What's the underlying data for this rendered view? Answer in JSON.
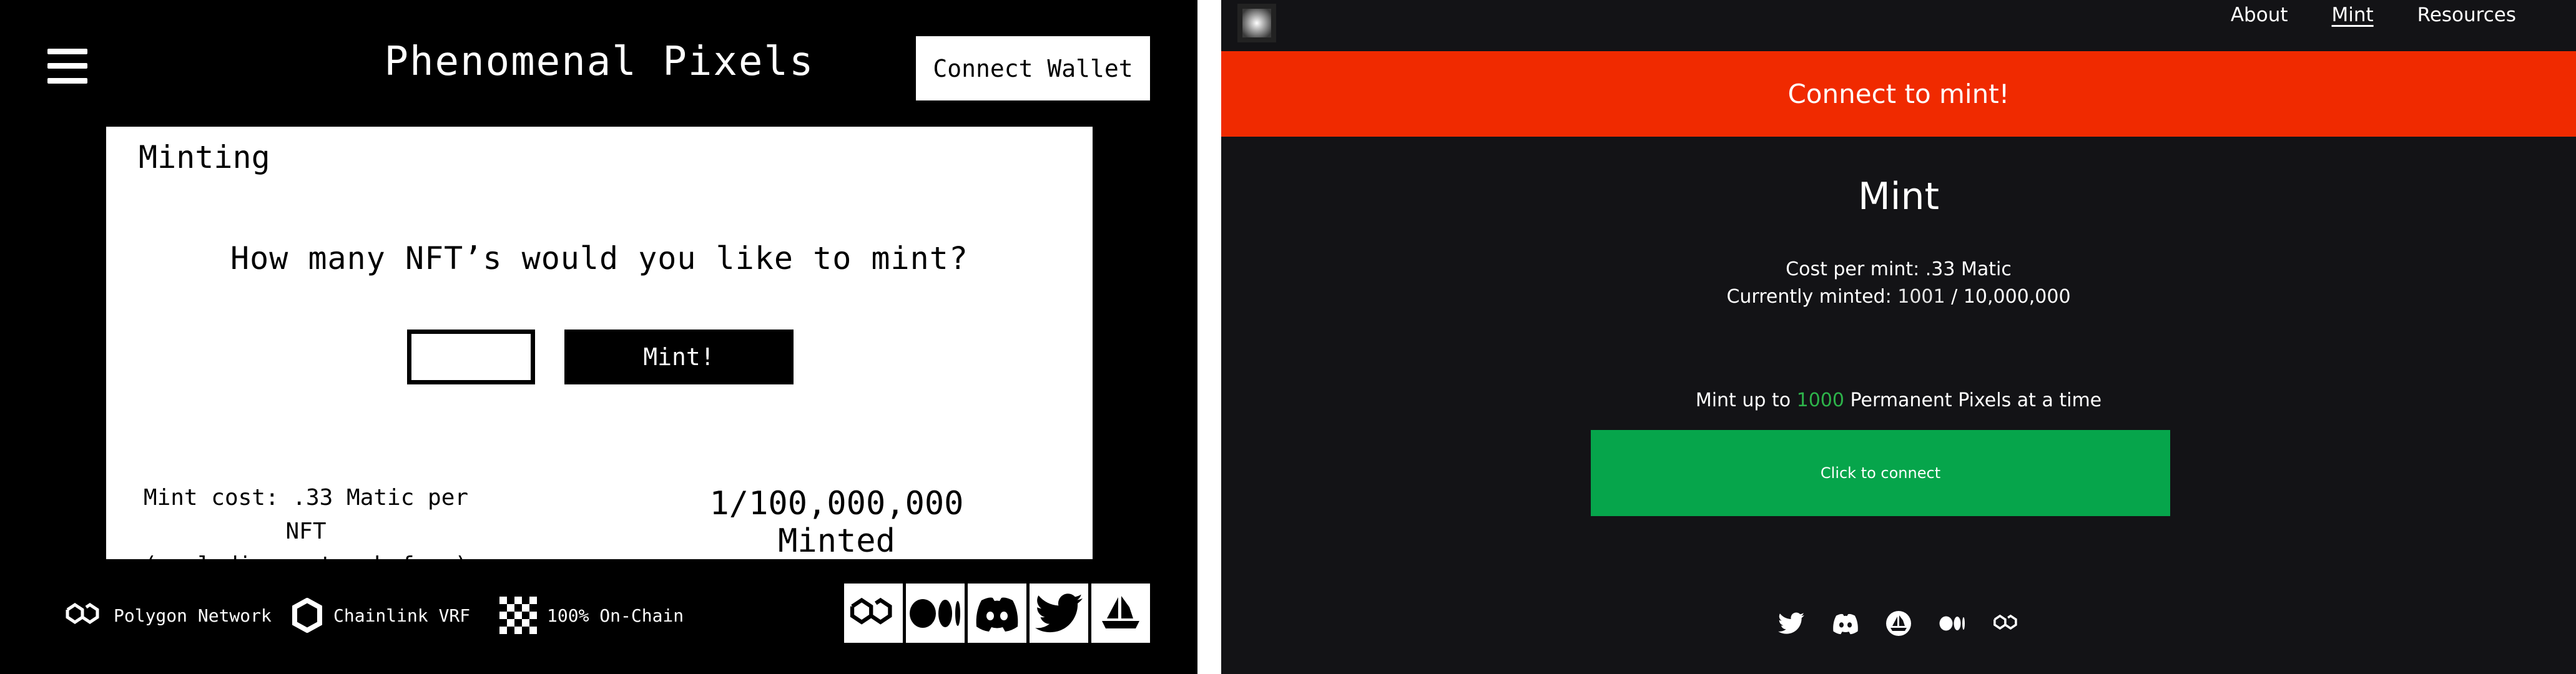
{
  "left_app": {
    "title": "Phenomenal Pixels",
    "connect_wallet_label": "Connect Wallet",
    "card": {
      "title": "Minting",
      "question": "How many NFT’s would you like to mint?",
      "quantity_value": "",
      "mint_button_label": "Mint!",
      "cost_line1": "Mint cost: .33 Matic per NFT",
      "cost_line2": "(excluding network fees)",
      "minted_count": "1/100,000,000 Minted"
    },
    "features": [
      {
        "icon": "polygon-icon",
        "label": "Polygon Network"
      },
      {
        "icon": "chainlink-icon",
        "label": "Chainlink VRF"
      },
      {
        "icon": "checker-icon",
        "label": "100% On-Chain"
      }
    ],
    "social_icons": [
      "polygon-icon",
      "medium-icon",
      "discord-icon",
      "twitter-icon",
      "opensea-icon"
    ]
  },
  "right_app": {
    "nav": {
      "about": "About",
      "mint": "Mint",
      "resources": "Resources"
    },
    "banner_text": "Connect to mint!",
    "heading": "Mint",
    "cost_per_mint": "Cost per mint: .33 Matic",
    "currently_minted_label": "Currently minted:",
    "currently_minted_value": "1001",
    "currently_minted_total": "/ 10,000,000",
    "mint_up_to_prefix": "Mint up to",
    "mint_up_to_value": "1000",
    "mint_up_to_suffix": "Permanent Pixels at a time",
    "connect_button_label": "Click to connect",
    "social_icons": [
      "twitter-icon",
      "discord-icon",
      "opensea-icon",
      "medium-icon",
      "polygon-icon"
    ]
  },
  "colors": {
    "banner": "#f02a00",
    "connect_button": "#06a54b",
    "highlight_green": "#2db34a",
    "right_bg": "#131316"
  }
}
